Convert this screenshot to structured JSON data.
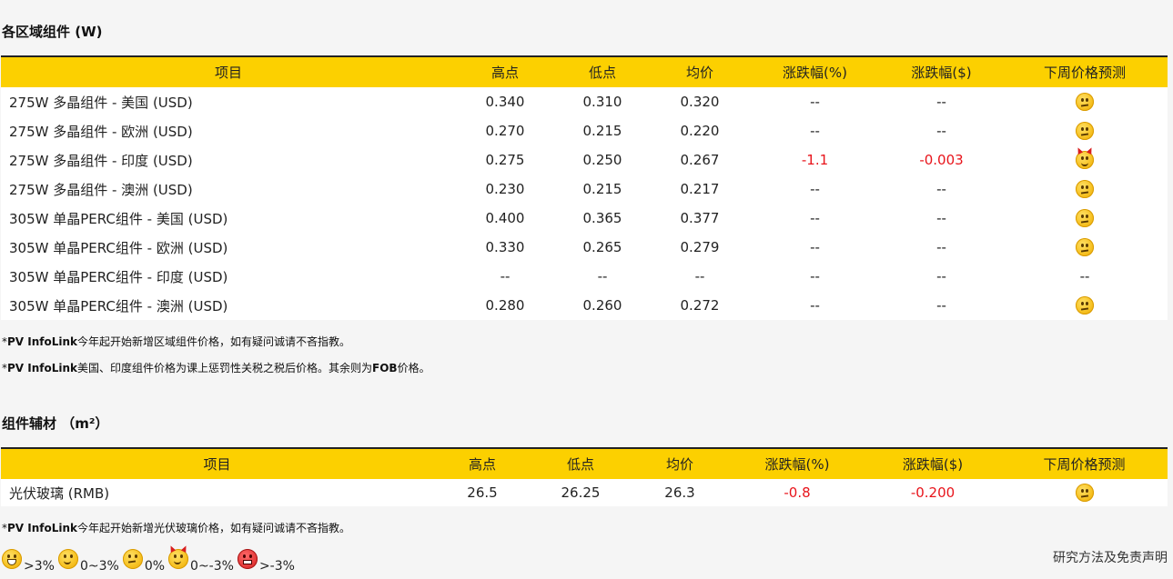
{
  "section1": {
    "title": "各区域组件 (W)",
    "headers": [
      "项目",
      "高点",
      "低点",
      "均价",
      "涨跌幅(%)",
      "涨跌幅($)",
      "下周价格预测"
    ],
    "rows": [
      {
        "name": "275W 多晶组件 - 美国 (USD)",
        "high": "0.340",
        "low": "0.310",
        "avg": "0.320",
        "pct": "--",
        "abs": "--",
        "forecast": "neutral-face-icon"
      },
      {
        "name": "275W 多晶组件 - 欧洲 (USD)",
        "high": "0.270",
        "low": "0.215",
        "avg": "0.220",
        "pct": "--",
        "abs": "--",
        "forecast": "neutral-face-icon"
      },
      {
        "name": "275W 多晶组件 - 印度 (USD)",
        "high": "0.275",
        "low": "0.250",
        "avg": "0.267",
        "pct": "-1.1",
        "abs": "-0.003",
        "forecast": "devil-face-icon"
      },
      {
        "name": "275W 多晶组件 - 澳洲 (USD)",
        "high": "0.230",
        "low": "0.215",
        "avg": "0.217",
        "pct": "--",
        "abs": "--",
        "forecast": "neutral-face-icon"
      },
      {
        "name": "305W 单晶PERC组件 - 美国 (USD)",
        "high": "0.400",
        "low": "0.365",
        "avg": "0.377",
        "pct": "--",
        "abs": "--",
        "forecast": "neutral-face-icon"
      },
      {
        "name": "305W 单晶PERC组件 - 欧洲 (USD)",
        "high": "0.330",
        "low": "0.265",
        "avg": "0.279",
        "pct": "--",
        "abs": "--",
        "forecast": "neutral-face-icon"
      },
      {
        "name": "305W 单晶PERC组件 - 印度 (USD)",
        "high": "--",
        "low": "--",
        "avg": "--",
        "pct": "--",
        "abs": "--",
        "forecast": "--"
      },
      {
        "name": "305W 单晶PERC组件 - 澳洲 (USD)",
        "high": "0.280",
        "low": "0.260",
        "avg": "0.272",
        "pct": "--",
        "abs": "--",
        "forecast": "neutral-face-icon"
      }
    ],
    "note1_brand": "PV InfoLink",
    "note1_text": "今年起开始新增区域组件价格，如有疑问诚请不吝指教。",
    "note2_brand": "PV InfoLink",
    "note2_text": "美国、印度组件价格为课上惩罚性关税之税后价格。其余则为",
    "note2_bold": "FOB",
    "note2_tail": "价格。"
  },
  "section2": {
    "title": "组件辅材 （m²）",
    "headers": [
      "项目",
      "高点",
      "低点",
      "均价",
      "涨跌幅(%)",
      "涨跌幅($)",
      "下周价格预测"
    ],
    "rows": [
      {
        "name": "光伏玻璃 (RMB)",
        "high": "26.5",
        "low": "26.25",
        "avg": "26.3",
        "pct": "-0.8",
        "abs": "-0.200",
        "forecast": "neutral-face-icon"
      }
    ],
    "note_brand": "PV InfoLink",
    "note_text": "今年起开始新增光伏玻璃价格，如有疑问诚请不吝指教。"
  },
  "legend": [
    {
      "icon": "big-smile-face-icon",
      "label": ">3%"
    },
    {
      "icon": "smile-face-icon",
      "label": "0~3%"
    },
    {
      "icon": "neutral-face-icon",
      "label": "0%"
    },
    {
      "icon": "devil-face-icon",
      "label": "0~-3%"
    },
    {
      "icon": "angry-face-icon",
      "label": ">-3%"
    }
  ],
  "disclaimer_link": "研究方法及免责声明",
  "colors": {
    "header_bg": "#fcd000",
    "negative": "#e8141b",
    "page_bg": "#f5f5f5"
  }
}
